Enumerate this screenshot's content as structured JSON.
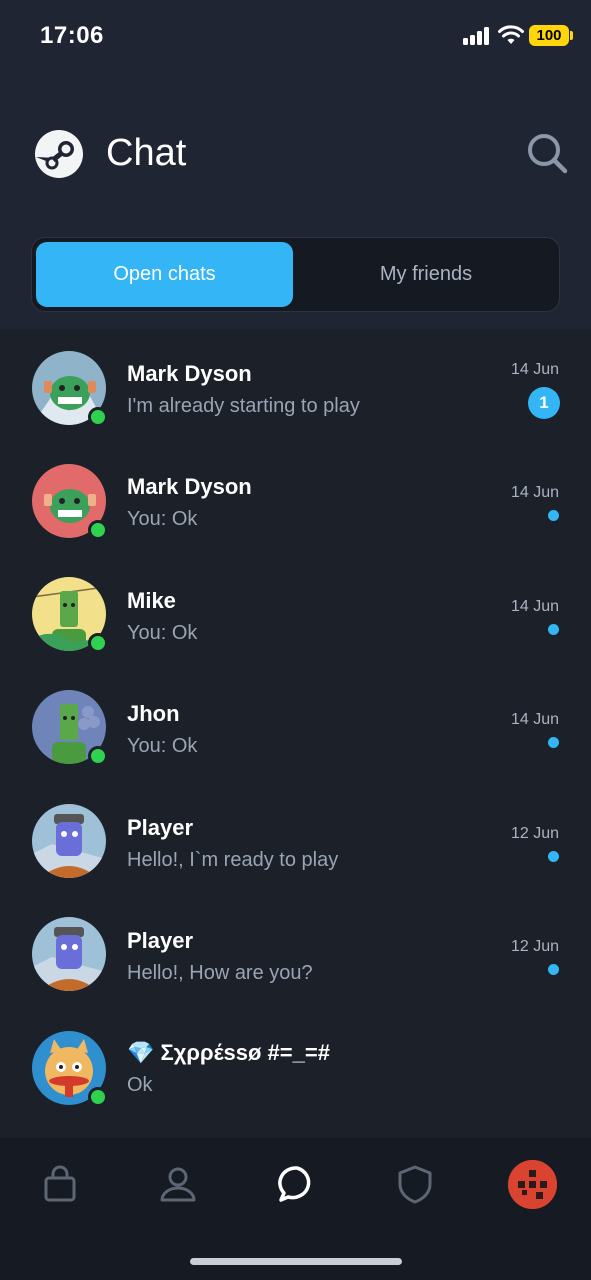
{
  "status_bar": {
    "time": "17:06",
    "battery": "100"
  },
  "header": {
    "title": "Chat"
  },
  "tabs": [
    {
      "label": "Open chats",
      "active": true
    },
    {
      "label": "My friends",
      "active": false
    }
  ],
  "chats": [
    {
      "name": "Mark Dyson",
      "preview": "I'm already starting to play",
      "date": "14 Jun",
      "unread_count": "1",
      "online": true,
      "avatar_bg": "#8fb3c8"
    },
    {
      "name": "Mark Dyson",
      "preview": "You: Ok",
      "date": "14 Jun",
      "unread_count": null,
      "online": true,
      "avatar_bg": "#e26a6a"
    },
    {
      "name": "Mike",
      "preview": "You: Ok",
      "date": "14 Jun",
      "unread_count": null,
      "online": true,
      "avatar_bg": "#f2e08a"
    },
    {
      "name": "Jhon",
      "preview": "You: Ok",
      "date": "14 Jun",
      "unread_count": null,
      "online": true,
      "avatar_bg": "#6f84b8"
    },
    {
      "name": "Player",
      "preview": "Hello!, I`m ready to play",
      "date": "12 Jun",
      "unread_count": null,
      "online": false,
      "avatar_bg": "#9ec1d8"
    },
    {
      "name": "Player",
      "preview": "Hello!, How are you?",
      "date": "12 Jun",
      "unread_count": null,
      "online": false,
      "avatar_bg": "#9ec1d8"
    },
    {
      "name": "💎 Σχρρέssø #=_=#",
      "preview": "Ok",
      "date": "",
      "unread_count": null,
      "online": true,
      "avatar_bg": "#2f8fcf"
    }
  ],
  "bottom_nav": {
    "items": [
      "store-icon",
      "profile-icon",
      "chat-icon",
      "guard-icon",
      "user-avatar"
    ],
    "active": "chat-icon"
  },
  "colors": {
    "accent": "#34b5f5",
    "online": "#2fd24f",
    "background": "#1b2029"
  }
}
